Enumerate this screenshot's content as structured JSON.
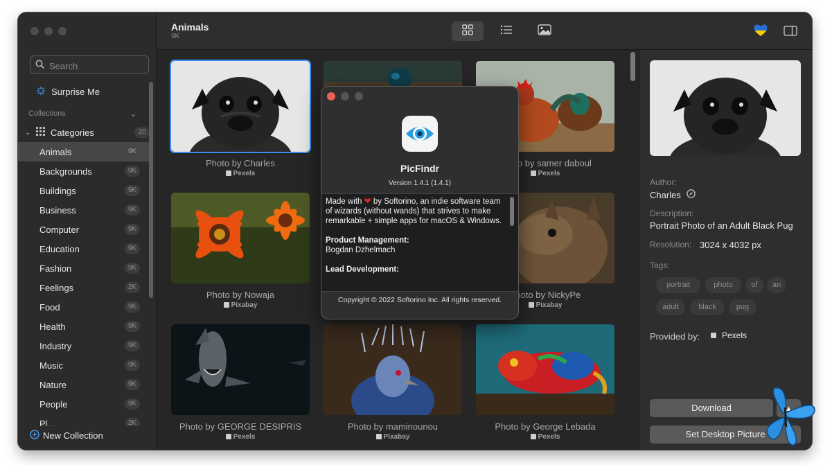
{
  "sidebar": {
    "search_placeholder": "Search",
    "surprise_label": "Surprise Me",
    "collections_header": "Collections",
    "categories": {
      "label": "Categories",
      "count": "20"
    },
    "items": [
      {
        "label": "Animals",
        "count": "9K",
        "selected": true
      },
      {
        "label": "Backgrounds",
        "count": "9K"
      },
      {
        "label": "Buildings",
        "count": "9K"
      },
      {
        "label": "Business",
        "count": "9K"
      },
      {
        "label": "Computer",
        "count": "9K"
      },
      {
        "label": "Education",
        "count": "9K"
      },
      {
        "label": "Fashion",
        "count": "9K"
      },
      {
        "label": "Feelings",
        "count": "2K"
      },
      {
        "label": "Food",
        "count": "9K"
      },
      {
        "label": "Health",
        "count": "9K"
      },
      {
        "label": "Industry",
        "count": "9K"
      },
      {
        "label": "Music",
        "count": "9K"
      },
      {
        "label": "Nature",
        "count": "9K"
      },
      {
        "label": "People",
        "count": "9K"
      },
      {
        "label": "Pl...",
        "count": "2K"
      }
    ],
    "new_collection_label": "New Collection"
  },
  "toolbar": {
    "title": "Animals",
    "subtitle": "9K",
    "view_modes": [
      "grid-view-icon",
      "list-view-icon",
      "image-view-icon"
    ],
    "active_view": "grid"
  },
  "grid": {
    "photos": [
      {
        "caption": "Photo by Charles",
        "source": "Pexels",
        "subject": "pug"
      },
      {
        "caption": "",
        "source": "",
        "subject": "duck"
      },
      {
        "caption": "Photo by samer daboul",
        "source": "Pexels",
        "subject": "rooster"
      },
      {
        "caption": "Photo by Nowaja",
        "source": "Pixabay",
        "subject": "flower"
      },
      {
        "caption": "",
        "source": "",
        "subject": "hidden"
      },
      {
        "caption": "Photo by NickyPe",
        "source": "Pixabay",
        "subject": "deer"
      },
      {
        "caption": "Photo by GEORGE DESIPRIS",
        "source": "Pexels",
        "subject": "shark"
      },
      {
        "caption": "Photo by maminounou",
        "source": "Pixabay",
        "subject": "pigeon"
      },
      {
        "caption": "Photo by George Lebada",
        "source": "Pexels",
        "subject": "chameleon"
      }
    ]
  },
  "detail": {
    "author_label": "Author:",
    "author": "Charles",
    "description_label": "Description:",
    "description": "Portrait Photo of an Adult Black Pug",
    "resolution_label": "Resolution:",
    "resolution": "3024 x 4032 px",
    "tags_label": "Tags:",
    "tags": [
      "portrait",
      "photo",
      "of",
      "an",
      "adult",
      "black",
      "pug"
    ],
    "provided_label": "Provided by:",
    "provider": "Pexels",
    "download_label": "Download",
    "set_desktop_label": "Set Desktop Picture"
  },
  "about": {
    "app_name": "PicFindr",
    "version": "Version 1.4.1 (1.4.1)",
    "body_intro_1": "Made with",
    "body_intro_2": "by Softorino, an indie software team of wizards (without wands) that strives to make remarkable + simple apps for macOS & Windows.",
    "pm_header": "Product Management:",
    "pm_name": "Bogdan Dzhelmach",
    "next_header": "Lead Development:",
    "copyright": "Copyright © 2022 Softorino Inc. All rights reserved."
  },
  "colors": {
    "accent": "#3b8df1",
    "heart": "#e0242c",
    "ukraine_blue": "#2a6fd6",
    "ukraine_yellow": "#f5d000"
  }
}
